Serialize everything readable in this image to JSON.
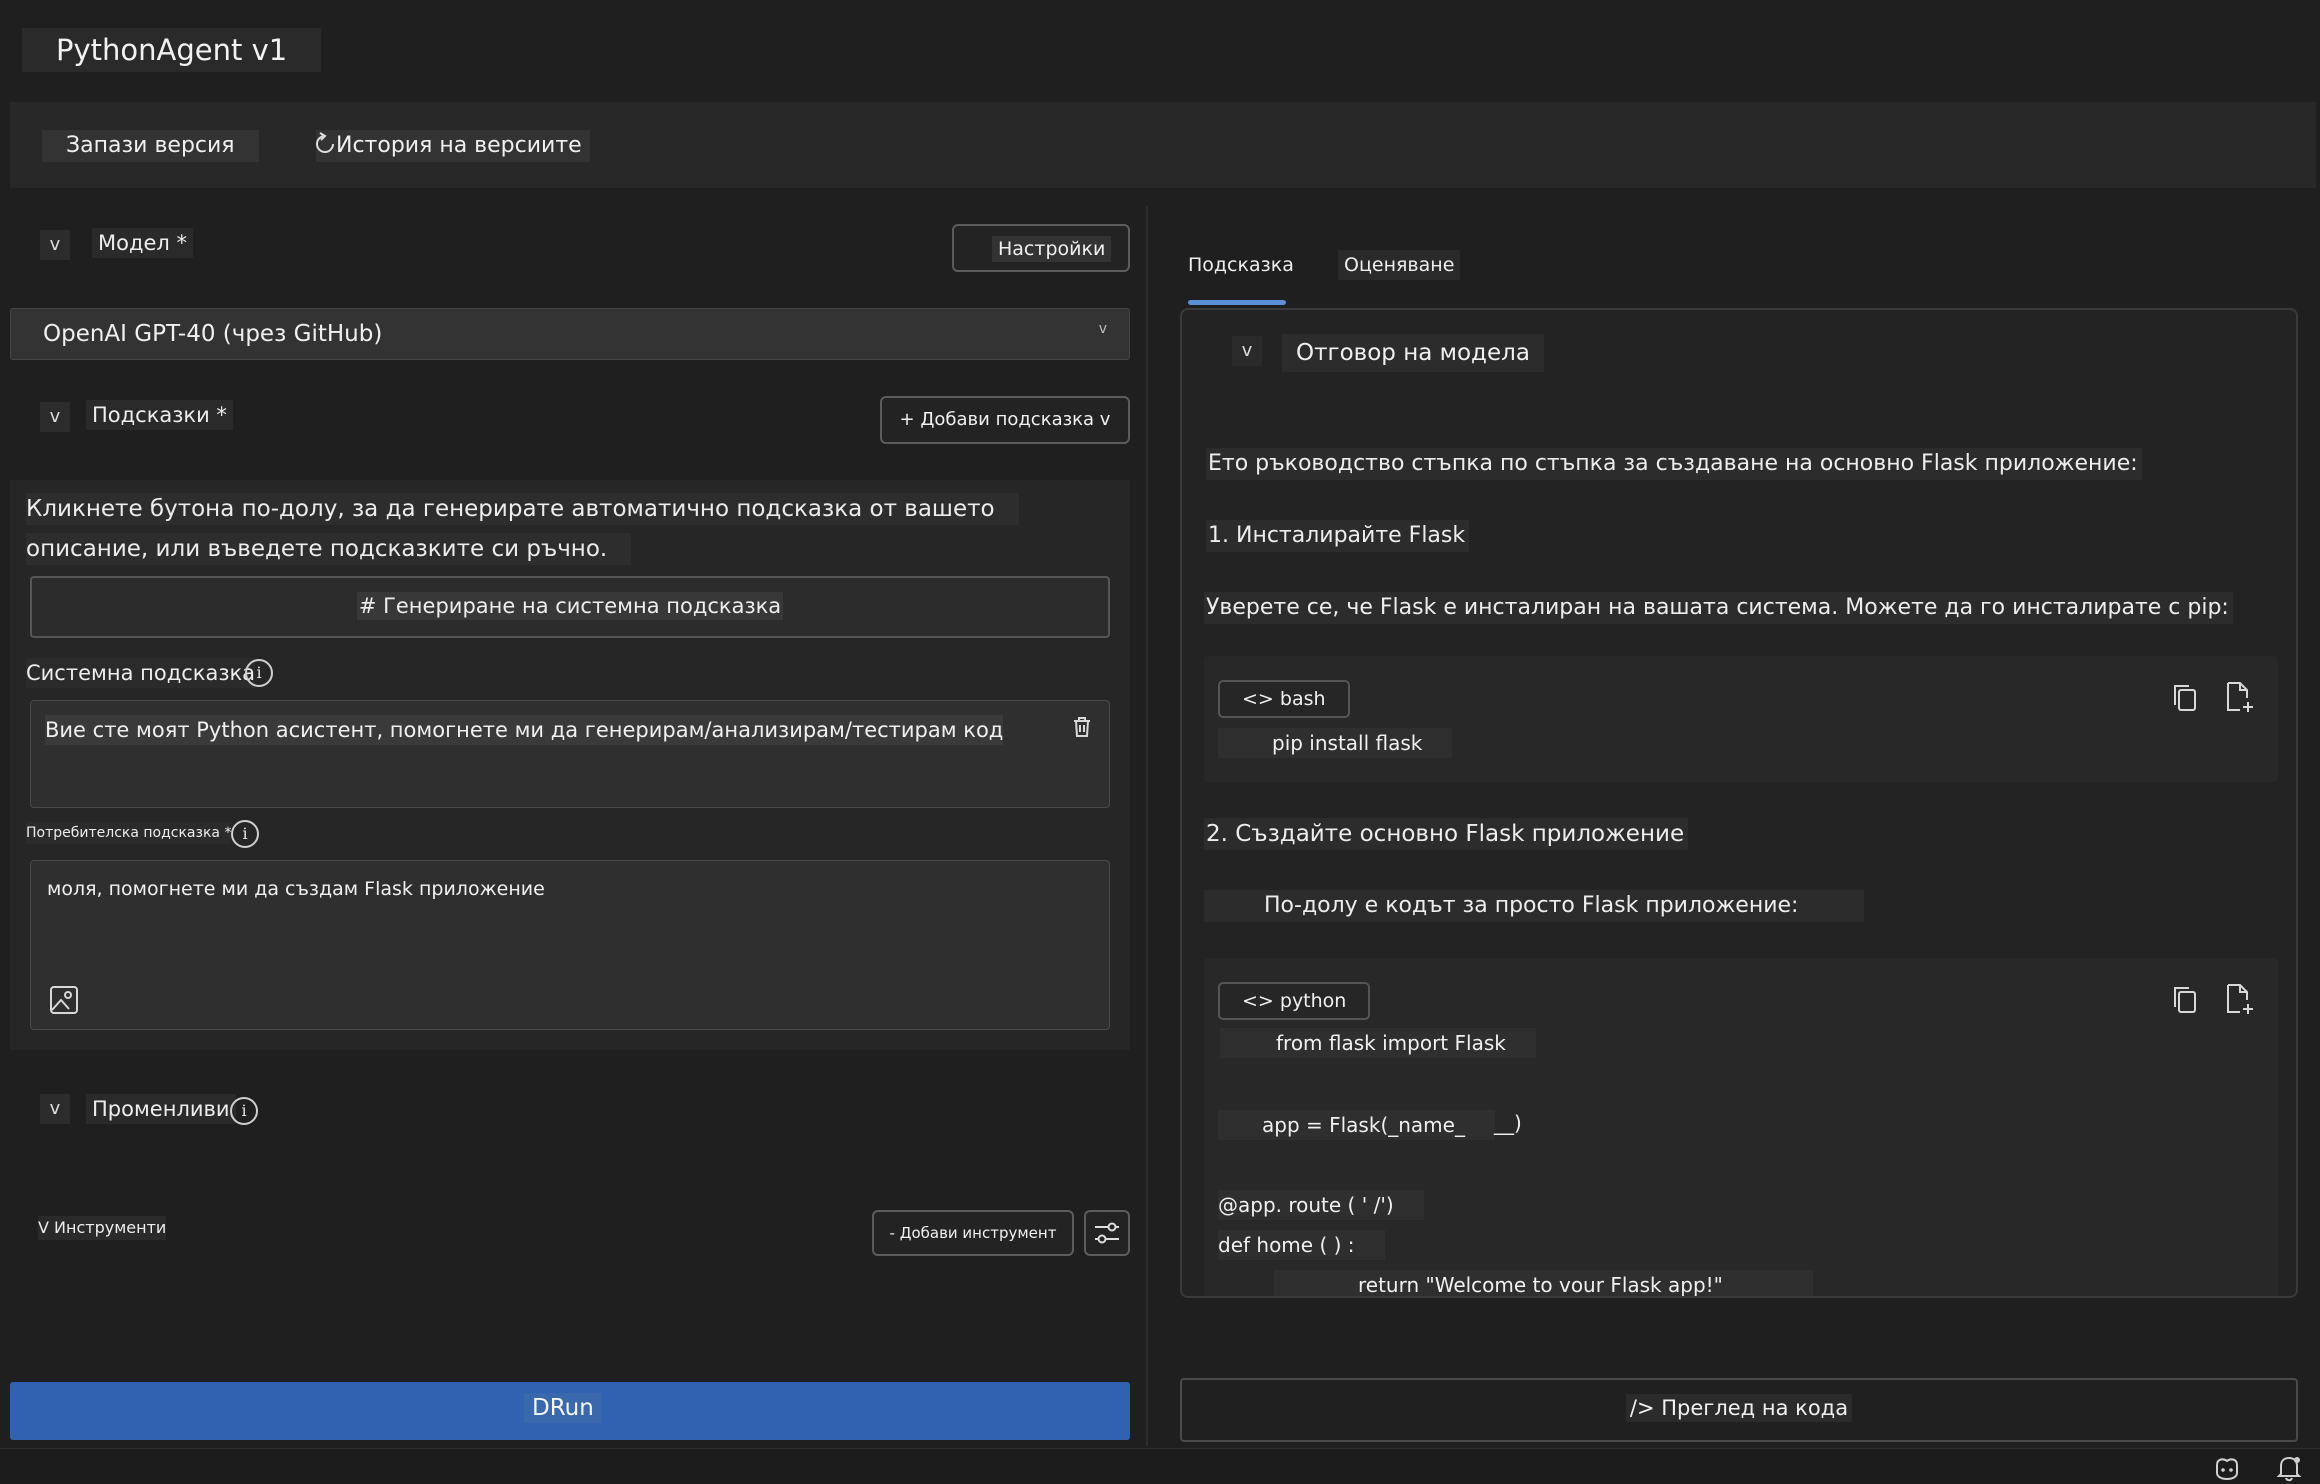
{
  "app": {
    "title": "PythonAgent v1"
  },
  "toolbar": {
    "save_version": "Запази версия",
    "version_history": "История на версиите"
  },
  "left": {
    "model_section": {
      "toggle": "v",
      "label": "Модел *",
      "settings_button": "Настройки",
      "selected_model": "OpenAI GPT-40 (чрез GitHub)",
      "select_caret": "v"
    },
    "prompts_section": {
      "toggle": "v",
      "label": "Подсказки *",
      "add_prompt_button": "+ Добави подсказка v",
      "description_line1": "Кликнете бутона по-долу, за да генерирате автоматично подсказка от вашето",
      "description_line2": "описание, или въведете подсказките си ръчно.",
      "generate_button": "# Генериране на системна подсказка",
      "system_prompt_label": "Системна подсказка",
      "system_prompt_value": "Вие сте моят Python асистент, помогнете ми да генерирам/анализирам/тестирам код",
      "user_prompt_label": "Потребителска подсказка *",
      "user_prompt_value": "моля, помогнете ми да създам Flask приложение",
      "info_glyph": "i"
    },
    "variables_section": {
      "toggle": "v",
      "label": "Променливи",
      "info_glyph": "i"
    },
    "tools_section": {
      "label": "V Инструменти",
      "add_tool_button": "- Добави инструмент"
    },
    "run_button": "DRun"
  },
  "right": {
    "tabs": [
      {
        "label": "Подсказка",
        "active": true
      },
      {
        "label": "Оценяване",
        "active": false
      }
    ],
    "response": {
      "toggle": "v",
      "title": "Отговор на модела",
      "intro": "Ето ръководство стъпка по стъпка за създаване на основно Flask приложение:",
      "step1_heading": "1. Инсталирайте Flask",
      "step1_text": "Уверете се, че Flask е инсталиран на вашата система. Можете да го инсталирате с pip:",
      "bash_block": {
        "lang": "<> bash",
        "code": "pip install flask"
      },
      "step2_heading": "2. Създайте основно Flask приложение",
      "step2_text": "По-долу е кодът за просто Flask приложение:",
      "python_block": {
        "lang": "<> python",
        "lines": [
          "from flask import Flask",
          "app = Flask(_name_",
          "__)",
          "@app. route ( ' /')",
          "def home ( ) :",
          "return \"Welcome to vour Flask app!\""
        ]
      }
    },
    "code_view_button": "/> Преглед на кода"
  },
  "colors": {
    "background": "#1f1f1f",
    "run_button": "#2f62b1",
    "tab_underline": "#5b8fd6"
  },
  "icons": [
    "history-icon",
    "copy-icon",
    "new-file-icon",
    "trash-icon",
    "image-icon",
    "sliders-icon",
    "copilot-icon",
    "bell-icon"
  ]
}
